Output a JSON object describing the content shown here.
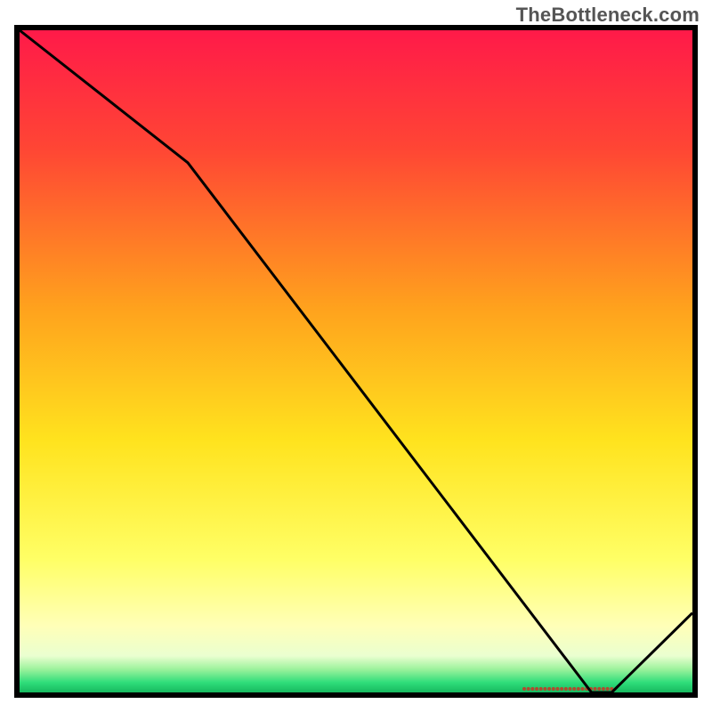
{
  "watermark": "TheBottleneck.com",
  "chart_data": {
    "type": "line",
    "title": "",
    "xlabel": "",
    "ylabel": "",
    "xlim": [
      0,
      100
    ],
    "ylim": [
      0,
      100
    ],
    "x": [
      0,
      25,
      85,
      88,
      100
    ],
    "values": [
      100,
      80,
      0,
      0,
      12
    ],
    "optimal_band": {
      "x_start": 75,
      "x_end": 88
    },
    "gradient_stops": [
      {
        "offset": 0.0,
        "color": "#ff1a49"
      },
      {
        "offset": 0.18,
        "color": "#ff4634"
      },
      {
        "offset": 0.42,
        "color": "#ffa21d"
      },
      {
        "offset": 0.62,
        "color": "#ffe31e"
      },
      {
        "offset": 0.8,
        "color": "#ffff66"
      },
      {
        "offset": 0.9,
        "color": "#ffffb8"
      },
      {
        "offset": 0.945,
        "color": "#eaffd0"
      },
      {
        "offset": 0.965,
        "color": "#9cf29c"
      },
      {
        "offset": 0.985,
        "color": "#2fdd7a"
      },
      {
        "offset": 1.0,
        "color": "#17b95f"
      }
    ],
    "optimal_marker_color": "#b04a2f"
  }
}
